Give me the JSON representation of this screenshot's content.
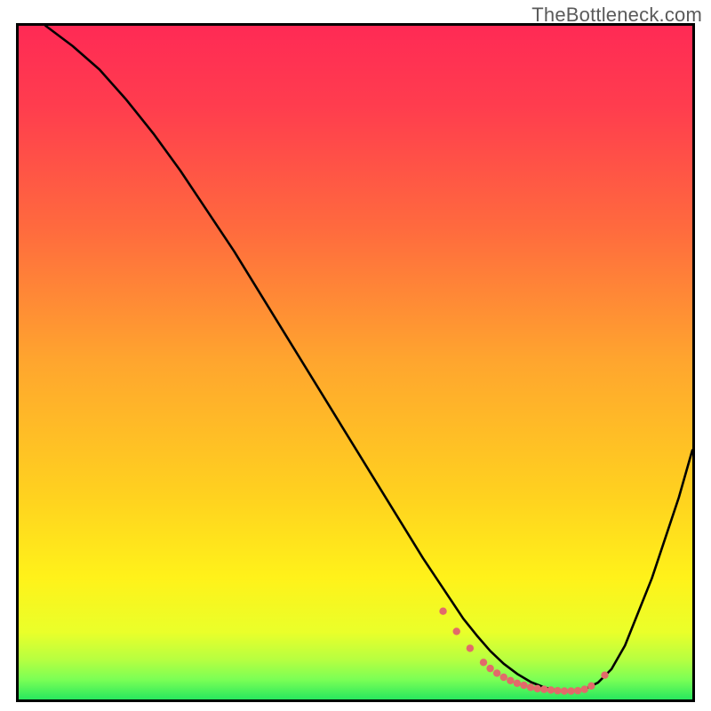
{
  "watermark": "TheBottleneck.com",
  "colors": {
    "curve": "#000000",
    "dots": "#e26a6a",
    "gradient_stops": [
      {
        "offset": 0.0,
        "color": "#ff2a55"
      },
      {
        "offset": 0.12,
        "color": "#ff3d4e"
      },
      {
        "offset": 0.3,
        "color": "#ff6a3e"
      },
      {
        "offset": 0.5,
        "color": "#ffa62e"
      },
      {
        "offset": 0.7,
        "color": "#ffd21f"
      },
      {
        "offset": 0.82,
        "color": "#fff21a"
      },
      {
        "offset": 0.9,
        "color": "#eaff2a"
      },
      {
        "offset": 0.94,
        "color": "#b8ff40"
      },
      {
        "offset": 0.97,
        "color": "#7cff55"
      },
      {
        "offset": 1.0,
        "color": "#28e85e"
      }
    ]
  },
  "chart_data": {
    "type": "line",
    "title": "",
    "xlabel": "",
    "ylabel": "",
    "xlim": [
      0,
      100
    ],
    "ylim": [
      0,
      100
    ],
    "series": [
      {
        "name": "curve",
        "x": [
          4,
          8,
          12,
          16,
          20,
          24,
          28,
          32,
          36,
          40,
          44,
          48,
          52,
          56,
          60,
          62,
          64,
          66,
          68,
          70,
          72,
          74,
          76,
          78,
          80,
          82,
          84,
          86,
          88,
          90,
          94,
          98,
          100
        ],
        "y": [
          100,
          97,
          93.5,
          89,
          84,
          78.5,
          72.5,
          66.5,
          60,
          53.5,
          47,
          40.5,
          34,
          27.5,
          21,
          18,
          15,
          12,
          9.5,
          7.2,
          5.3,
          3.8,
          2.6,
          1.8,
          1.3,
          1.2,
          1.5,
          2.5,
          4.5,
          8,
          18,
          30,
          37
        ]
      }
    ],
    "dots_series": {
      "name": "optimal-region-dots",
      "x": [
        63,
        65,
        67,
        69,
        70,
        71,
        72,
        73,
        74,
        75,
        76,
        77,
        78,
        79,
        80,
        81,
        82,
        83,
        84,
        85,
        87
      ],
      "y": [
        13.1,
        10.1,
        7.6,
        5.5,
        4.6,
        3.9,
        3.3,
        2.8,
        2.4,
        2.1,
        1.8,
        1.6,
        1.5,
        1.4,
        1.3,
        1.25,
        1.25,
        1.3,
        1.5,
        2.0,
        3.6
      ]
    }
  }
}
